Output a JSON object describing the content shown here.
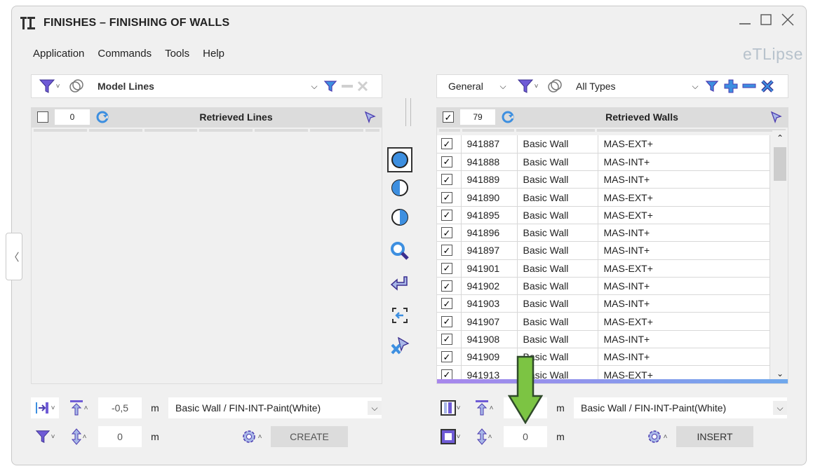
{
  "window": {
    "title": "FINISHES – FINISHING OF WALLS",
    "brand": "eTLipse",
    "controls": {
      "minimize": "minimize-icon",
      "maximize": "maximize-icon",
      "close": "close-icon"
    }
  },
  "menu": {
    "items": [
      "Application",
      "Commands",
      "Tools",
      "Help"
    ]
  },
  "left": {
    "filter_combo": "Model Lines",
    "count": "0",
    "list_title": "Retrieved Lines",
    "offset_value": "-0,5",
    "offset_unit": "m",
    "type_combo": "Basic Wall / FIN-INT-Paint(White)",
    "height_value": "0",
    "height_unit": "m",
    "action_label": "CREATE"
  },
  "right": {
    "category_combo": "General",
    "filter_combo": "All Types",
    "count": "79",
    "list_title": "Retrieved Walls",
    "rows": [
      {
        "id": "941887",
        "family": "Basic Wall",
        "type": "MAS-EXT+"
      },
      {
        "id": "941888",
        "family": "Basic Wall",
        "type": "MAS-INT+"
      },
      {
        "id": "941889",
        "family": "Basic Wall",
        "type": "MAS-INT+"
      },
      {
        "id": "941890",
        "family": "Basic Wall",
        "type": "MAS-EXT+"
      },
      {
        "id": "941895",
        "family": "Basic Wall",
        "type": "MAS-EXT+"
      },
      {
        "id": "941896",
        "family": "Basic Wall",
        "type": "MAS-INT+"
      },
      {
        "id": "941897",
        "family": "Basic Wall",
        "type": "MAS-INT+"
      },
      {
        "id": "941901",
        "family": "Basic Wall",
        "type": "MAS-EXT+"
      },
      {
        "id": "941902",
        "family": "Basic Wall",
        "type": "MAS-INT+"
      },
      {
        "id": "941903",
        "family": "Basic Wall",
        "type": "MAS-INT+"
      },
      {
        "id": "941907",
        "family": "Basic Wall",
        "type": "MAS-EXT+"
      },
      {
        "id": "941908",
        "family": "Basic Wall",
        "type": "MAS-INT+"
      },
      {
        "id": "941909",
        "family": "Basic Wall",
        "type": "MAS-INT+"
      },
      {
        "id": "941913",
        "family": "Basic Wall",
        "type": "MAS-EXT+"
      }
    ],
    "offset_value": "",
    "offset_unit": "m",
    "type_combo": "Basic Wall / FIN-INT-Paint(White)",
    "height_value": "0",
    "height_unit": "m",
    "action_label": "INSERT"
  },
  "colors": {
    "accent_purple": "#6f5bd6",
    "accent_blue": "#3d8fe0",
    "icon_fill": "#a9b8e8",
    "callout_green": "#7cc443"
  }
}
